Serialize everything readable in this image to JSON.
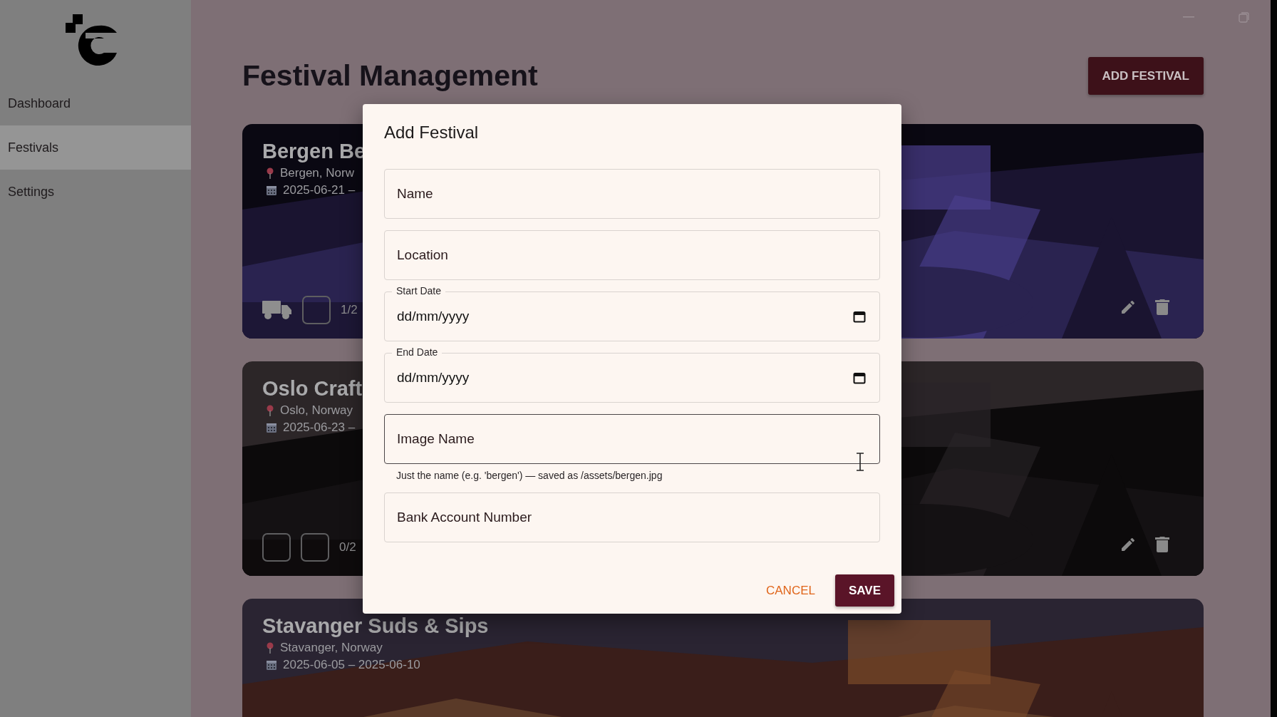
{
  "sidebar": {
    "items": [
      {
        "label": "Dashboard",
        "selected": false
      },
      {
        "label": "Festivals",
        "selected": true
      },
      {
        "label": "Settings",
        "selected": false
      }
    ]
  },
  "page": {
    "title": "Festival Management",
    "add_button": "ADD FESTIVAL"
  },
  "festivals": [
    {
      "name": "Bergen Be",
      "location": "Bergen, Norw",
      "dates": "2025-06-21 –",
      "slots": [
        {
          "kind": "truck"
        },
        {
          "kind": "empty"
        }
      ],
      "count": "1/2"
    },
    {
      "name": "Oslo Craft",
      "location": "Oslo, Norway",
      "dates": "2025-06-23 –",
      "slots": [
        {
          "kind": "empty"
        },
        {
          "kind": "empty"
        }
      ],
      "count": "0/2"
    },
    {
      "name": "Stavanger Suds & Sips",
      "location": "Stavanger, Norway",
      "dates": "2025-06-05 – 2025-06-10"
    }
  ],
  "dialog": {
    "title": "Add Festival",
    "fields": [
      {
        "kind": "text",
        "placeholder": "Name",
        "focused": false
      },
      {
        "kind": "text",
        "placeholder": "Location",
        "focused": false
      },
      {
        "kind": "date",
        "label": "Start Date",
        "placeholder": "dd/mm/yyyy",
        "focused": false
      },
      {
        "kind": "date",
        "label": "End Date",
        "placeholder": "dd/mm/yyyy",
        "focused": false
      },
      {
        "kind": "text",
        "placeholder": "Image Name",
        "focused": true,
        "helper": "Just the name (e.g. 'bergen') — saved as /assets/bergen.jpg"
      },
      {
        "kind": "text",
        "placeholder": "Bank Account Number",
        "focused": false
      }
    ],
    "cancel": "CANCEL",
    "save": "SAVE"
  }
}
